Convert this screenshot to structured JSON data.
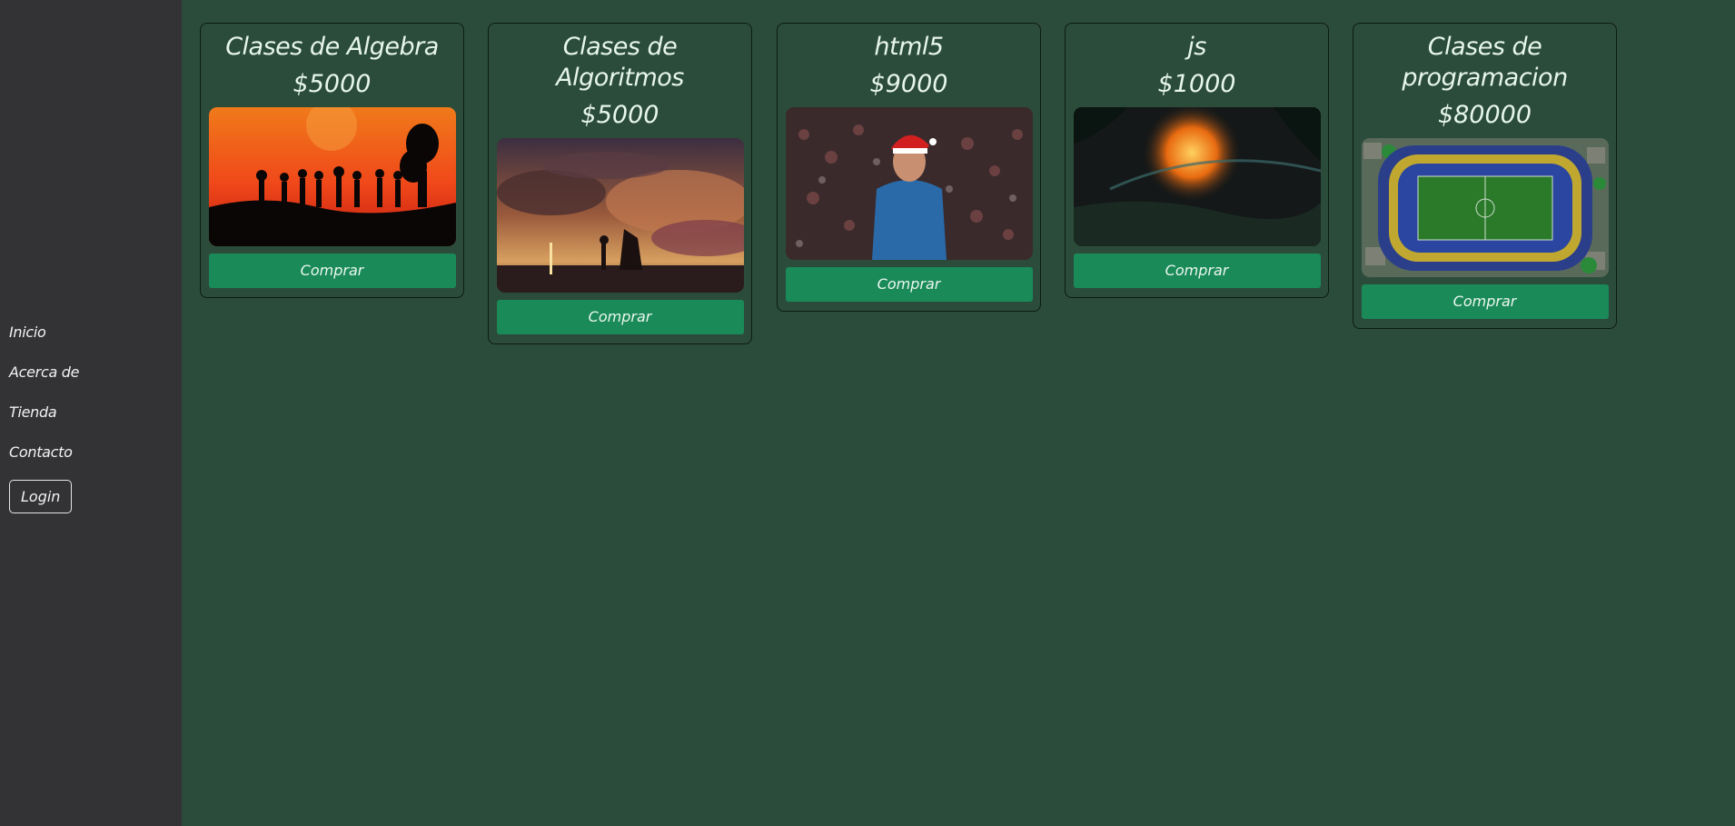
{
  "nav": {
    "items": [
      {
        "label": "Inicio"
      },
      {
        "label": "Acerca de"
      },
      {
        "label": "Tienda"
      },
      {
        "label": "Contacto"
      }
    ],
    "login_label": "Login"
  },
  "products": [
    {
      "title": "Clases de Algebra",
      "price": "$5000",
      "button": "Comprar"
    },
    {
      "title": "Clases de Algoritmos",
      "price": "$5000",
      "button": "Comprar"
    },
    {
      "title": "html5",
      "price": "$9000",
      "button": "Comprar"
    },
    {
      "title": "js",
      "price": "$1000",
      "button": "Comprar"
    },
    {
      "title": "Clases de programacion",
      "price": "$80000",
      "button": "Comprar"
    }
  ],
  "colors": {
    "background": "#2c4c3b",
    "sidebar": "#333235",
    "button": "#1a8a58"
  }
}
